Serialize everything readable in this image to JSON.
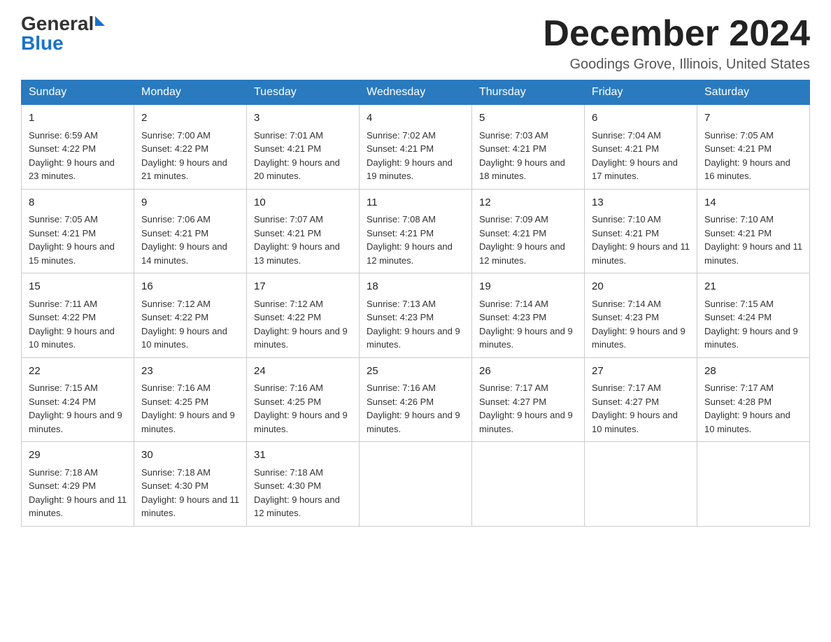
{
  "logo": {
    "general": "General",
    "blue": "Blue"
  },
  "title": {
    "month": "December 2024",
    "location": "Goodings Grove, Illinois, United States"
  },
  "headers": [
    "Sunday",
    "Monday",
    "Tuesday",
    "Wednesday",
    "Thursday",
    "Friday",
    "Saturday"
  ],
  "weeks": [
    [
      {
        "day": "1",
        "sunrise": "6:59 AM",
        "sunset": "4:22 PM",
        "daylight": "9 hours and 23 minutes."
      },
      {
        "day": "2",
        "sunrise": "7:00 AM",
        "sunset": "4:22 PM",
        "daylight": "9 hours and 21 minutes."
      },
      {
        "day": "3",
        "sunrise": "7:01 AM",
        "sunset": "4:21 PM",
        "daylight": "9 hours and 20 minutes."
      },
      {
        "day": "4",
        "sunrise": "7:02 AM",
        "sunset": "4:21 PM",
        "daylight": "9 hours and 19 minutes."
      },
      {
        "day": "5",
        "sunrise": "7:03 AM",
        "sunset": "4:21 PM",
        "daylight": "9 hours and 18 minutes."
      },
      {
        "day": "6",
        "sunrise": "7:04 AM",
        "sunset": "4:21 PM",
        "daylight": "9 hours and 17 minutes."
      },
      {
        "day": "7",
        "sunrise": "7:05 AM",
        "sunset": "4:21 PM",
        "daylight": "9 hours and 16 minutes."
      }
    ],
    [
      {
        "day": "8",
        "sunrise": "7:05 AM",
        "sunset": "4:21 PM",
        "daylight": "9 hours and 15 minutes."
      },
      {
        "day": "9",
        "sunrise": "7:06 AM",
        "sunset": "4:21 PM",
        "daylight": "9 hours and 14 minutes."
      },
      {
        "day": "10",
        "sunrise": "7:07 AM",
        "sunset": "4:21 PM",
        "daylight": "9 hours and 13 minutes."
      },
      {
        "day": "11",
        "sunrise": "7:08 AM",
        "sunset": "4:21 PM",
        "daylight": "9 hours and 12 minutes."
      },
      {
        "day": "12",
        "sunrise": "7:09 AM",
        "sunset": "4:21 PM",
        "daylight": "9 hours and 12 minutes."
      },
      {
        "day": "13",
        "sunrise": "7:10 AM",
        "sunset": "4:21 PM",
        "daylight": "9 hours and 11 minutes."
      },
      {
        "day": "14",
        "sunrise": "7:10 AM",
        "sunset": "4:21 PM",
        "daylight": "9 hours and 11 minutes."
      }
    ],
    [
      {
        "day": "15",
        "sunrise": "7:11 AM",
        "sunset": "4:22 PM",
        "daylight": "9 hours and 10 minutes."
      },
      {
        "day": "16",
        "sunrise": "7:12 AM",
        "sunset": "4:22 PM",
        "daylight": "9 hours and 10 minutes."
      },
      {
        "day": "17",
        "sunrise": "7:12 AM",
        "sunset": "4:22 PM",
        "daylight": "9 hours and 9 minutes."
      },
      {
        "day": "18",
        "sunrise": "7:13 AM",
        "sunset": "4:23 PM",
        "daylight": "9 hours and 9 minutes."
      },
      {
        "day": "19",
        "sunrise": "7:14 AM",
        "sunset": "4:23 PM",
        "daylight": "9 hours and 9 minutes."
      },
      {
        "day": "20",
        "sunrise": "7:14 AM",
        "sunset": "4:23 PM",
        "daylight": "9 hours and 9 minutes."
      },
      {
        "day": "21",
        "sunrise": "7:15 AM",
        "sunset": "4:24 PM",
        "daylight": "9 hours and 9 minutes."
      }
    ],
    [
      {
        "day": "22",
        "sunrise": "7:15 AM",
        "sunset": "4:24 PM",
        "daylight": "9 hours and 9 minutes."
      },
      {
        "day": "23",
        "sunrise": "7:16 AM",
        "sunset": "4:25 PM",
        "daylight": "9 hours and 9 minutes."
      },
      {
        "day": "24",
        "sunrise": "7:16 AM",
        "sunset": "4:25 PM",
        "daylight": "9 hours and 9 minutes."
      },
      {
        "day": "25",
        "sunrise": "7:16 AM",
        "sunset": "4:26 PM",
        "daylight": "9 hours and 9 minutes."
      },
      {
        "day": "26",
        "sunrise": "7:17 AM",
        "sunset": "4:27 PM",
        "daylight": "9 hours and 9 minutes."
      },
      {
        "day": "27",
        "sunrise": "7:17 AM",
        "sunset": "4:27 PM",
        "daylight": "9 hours and 10 minutes."
      },
      {
        "day": "28",
        "sunrise": "7:17 AM",
        "sunset": "4:28 PM",
        "daylight": "9 hours and 10 minutes."
      }
    ],
    [
      {
        "day": "29",
        "sunrise": "7:18 AM",
        "sunset": "4:29 PM",
        "daylight": "9 hours and 11 minutes."
      },
      {
        "day": "30",
        "sunrise": "7:18 AM",
        "sunset": "4:30 PM",
        "daylight": "9 hours and 11 minutes."
      },
      {
        "day": "31",
        "sunrise": "7:18 AM",
        "sunset": "4:30 PM",
        "daylight": "9 hours and 12 minutes."
      },
      null,
      null,
      null,
      null
    ]
  ],
  "labels": {
    "sunrise": "Sunrise: ",
    "sunset": "Sunset: ",
    "daylight": "Daylight: "
  }
}
